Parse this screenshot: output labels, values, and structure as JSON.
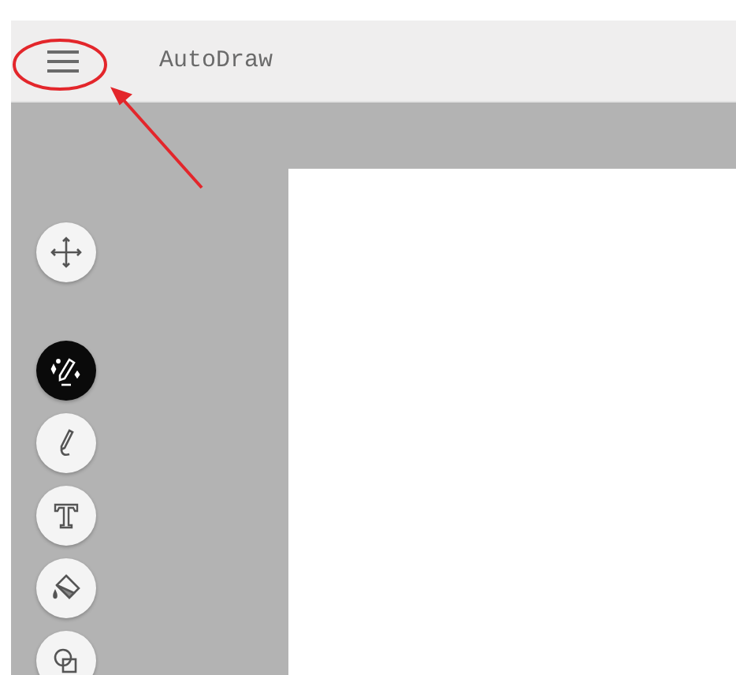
{
  "header": {
    "title": "AutoDraw"
  },
  "navigation_tools": [
    {
      "kind": "move",
      "selected": false
    }
  ],
  "drawing_tools": [
    {
      "kind": "autodraw",
      "selected": true
    },
    {
      "kind": "pencil",
      "selected": false
    },
    {
      "kind": "text",
      "selected": false
    },
    {
      "kind": "fill",
      "selected": false
    },
    {
      "kind": "shapes",
      "selected": false
    }
  ],
  "highlight_ellipse": {
    "color": "#e3262b"
  },
  "pointer_arrow": {
    "color": "#e3262b"
  }
}
